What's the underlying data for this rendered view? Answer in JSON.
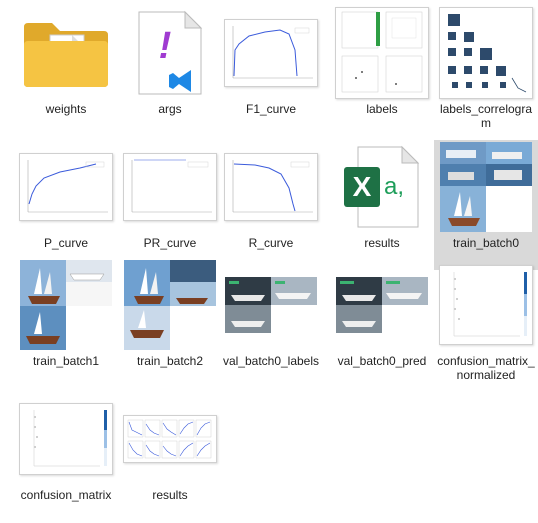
{
  "files": [
    {
      "label": "weights"
    },
    {
      "label": "args"
    },
    {
      "label": "F1_curve"
    },
    {
      "label": "labels"
    },
    {
      "label": "labels_correlogram"
    },
    {
      "label": "P_curve"
    },
    {
      "label": "PR_curve"
    },
    {
      "label": "R_curve"
    },
    {
      "label": "results"
    },
    {
      "label": "train_batch0"
    },
    {
      "label": "train_batch1"
    },
    {
      "label": "train_batch2"
    },
    {
      "label": "val_batch0_labels"
    },
    {
      "label": "val_batch0_pred"
    },
    {
      "label": "confusion_matrix_normalized"
    },
    {
      "label": "confusion_matrix"
    },
    {
      "label": "results"
    }
  ],
  "icons": {
    "excel_letter": "X",
    "excel_sub": "a,"
  },
  "colors": {
    "folder": "#f5c443",
    "vscode_purple": "#a03bd1",
    "vscode_blue": "#1e88e5",
    "excel_green": "#1e7145",
    "selection": "#d9d9d9",
    "curve": "#3b5bdb"
  }
}
